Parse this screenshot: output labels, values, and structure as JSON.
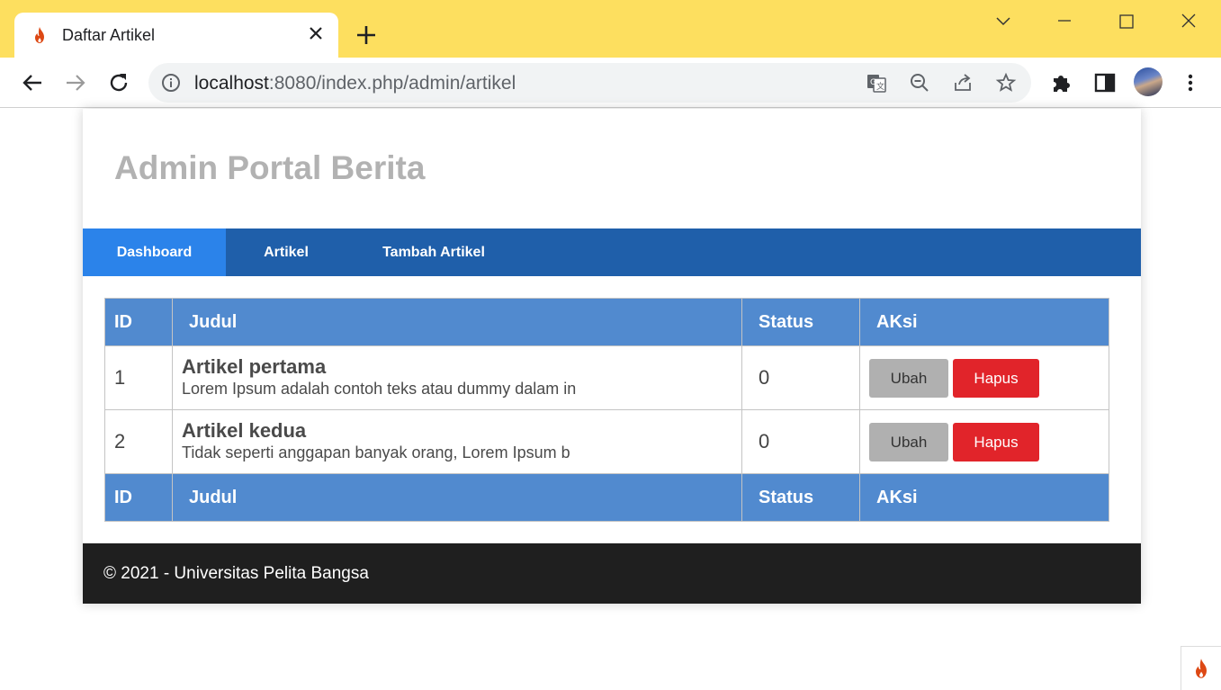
{
  "browser": {
    "tab_title": "Daftar Artikel",
    "url_host": "localhost",
    "url_path": ":8080/index.php/admin/artikel",
    "titlebar_color": "#fddf5f"
  },
  "page": {
    "site_title": "Admin Portal Berita",
    "nav": [
      {
        "label": "Dashboard"
      },
      {
        "label": "Artikel"
      },
      {
        "label": "Tambah Artikel"
      }
    ],
    "table": {
      "headers": [
        "ID",
        "Judul",
        "Status",
        "AKsi"
      ],
      "footers": [
        "ID",
        "Judul",
        "Status",
        "AKsi"
      ],
      "rows": [
        {
          "id": "1",
          "title": "Artikel pertama",
          "excerpt": "Lorem Ipsum adalah contoh teks atau dummy dalam in",
          "status": "0",
          "edit_label": "Ubah",
          "delete_label": "Hapus"
        },
        {
          "id": "2",
          "title": "Artikel kedua",
          "excerpt": "Tidak seperti anggapan banyak orang, Lorem Ipsum b",
          "status": "0",
          "edit_label": "Ubah",
          "delete_label": "Hapus"
        }
      ]
    },
    "footer_text": "© 2021 - Universitas Pelita Bangsa"
  },
  "colors": {
    "nav_bg": "#1f5faa",
    "nav_active": "#2b83ea",
    "table_header": "#518acf",
    "delete_button": "#e1242a",
    "edit_button": "#b0b0b0",
    "footer_bg": "#1f1f1f"
  },
  "icons": [
    "flame-icon",
    "close-icon",
    "plus-icon",
    "back-icon",
    "forward-icon",
    "reload-icon",
    "info-icon",
    "translate-icon",
    "zoom-out-icon",
    "share-icon",
    "star-icon",
    "puzzle-icon",
    "sidepanel-icon",
    "more-vert-icon",
    "minimize-icon",
    "maximize-icon",
    "window-close-icon",
    "chevron-down-icon"
  ]
}
